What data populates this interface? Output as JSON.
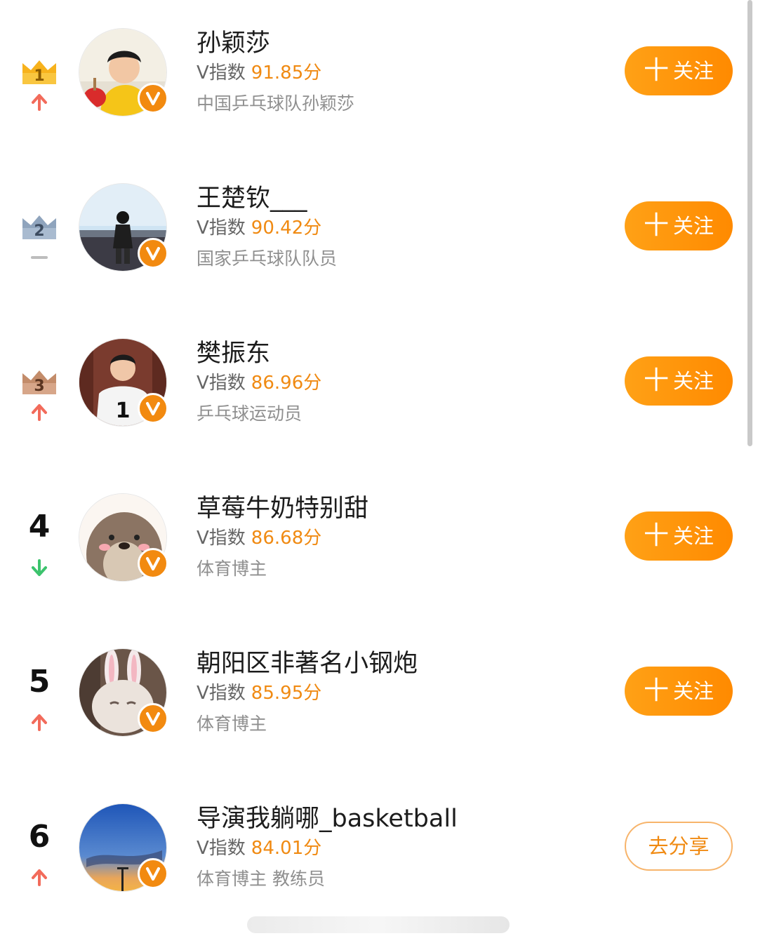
{
  "rows": [
    {
      "rank": "1",
      "rank_style": "gold-crown",
      "trend": "up",
      "name": "孙颖莎",
      "vindex_label": "V指数",
      "score": "91.85分",
      "desc": "中国乒乓球队孙颖莎",
      "action_label": "关注",
      "action_type": "follow"
    },
    {
      "rank": "2",
      "rank_style": "silver-crown",
      "trend": "same",
      "name": "王楚钦___",
      "vindex_label": "V指数",
      "score": "90.42分",
      "desc": "国家乒乓球队队员",
      "action_label": "关注",
      "action_type": "follow"
    },
    {
      "rank": "3",
      "rank_style": "bronze-crown",
      "trend": "up",
      "name": "樊振东",
      "vindex_label": "V指数",
      "score": "86.96分",
      "desc": "乒乓球运动员",
      "action_label": "关注",
      "action_type": "follow"
    },
    {
      "rank": "4",
      "rank_style": "number",
      "trend": "down",
      "name": "草莓牛奶特别甜",
      "vindex_label": "V指数",
      "score": "86.68分",
      "desc": "体育博主",
      "action_label": "关注",
      "action_type": "follow"
    },
    {
      "rank": "5",
      "rank_style": "number",
      "trend": "up",
      "name": "朝阳区非著名小钢炮",
      "vindex_label": "V指数",
      "score": "85.95分",
      "desc": "体育博主",
      "action_label": "关注",
      "action_type": "follow"
    },
    {
      "rank": "6",
      "rank_style": "number",
      "trend": "up",
      "name": "导演我躺哪_basketball",
      "vindex_label": "V指数",
      "score": "84.01分",
      "desc": "体育博主 教练员",
      "action_label": "去分享",
      "action_type": "share"
    }
  ],
  "follow_plus": "十",
  "colors": {
    "accent": "#ff9500",
    "score": "#f08a12",
    "trend_up": "#f26b5b",
    "trend_down": "#3cc36d",
    "trend_same": "#bdbdbd",
    "gold": "#f7b21c",
    "silver": "#8fa4bd",
    "bronze": "#c38c6a"
  }
}
